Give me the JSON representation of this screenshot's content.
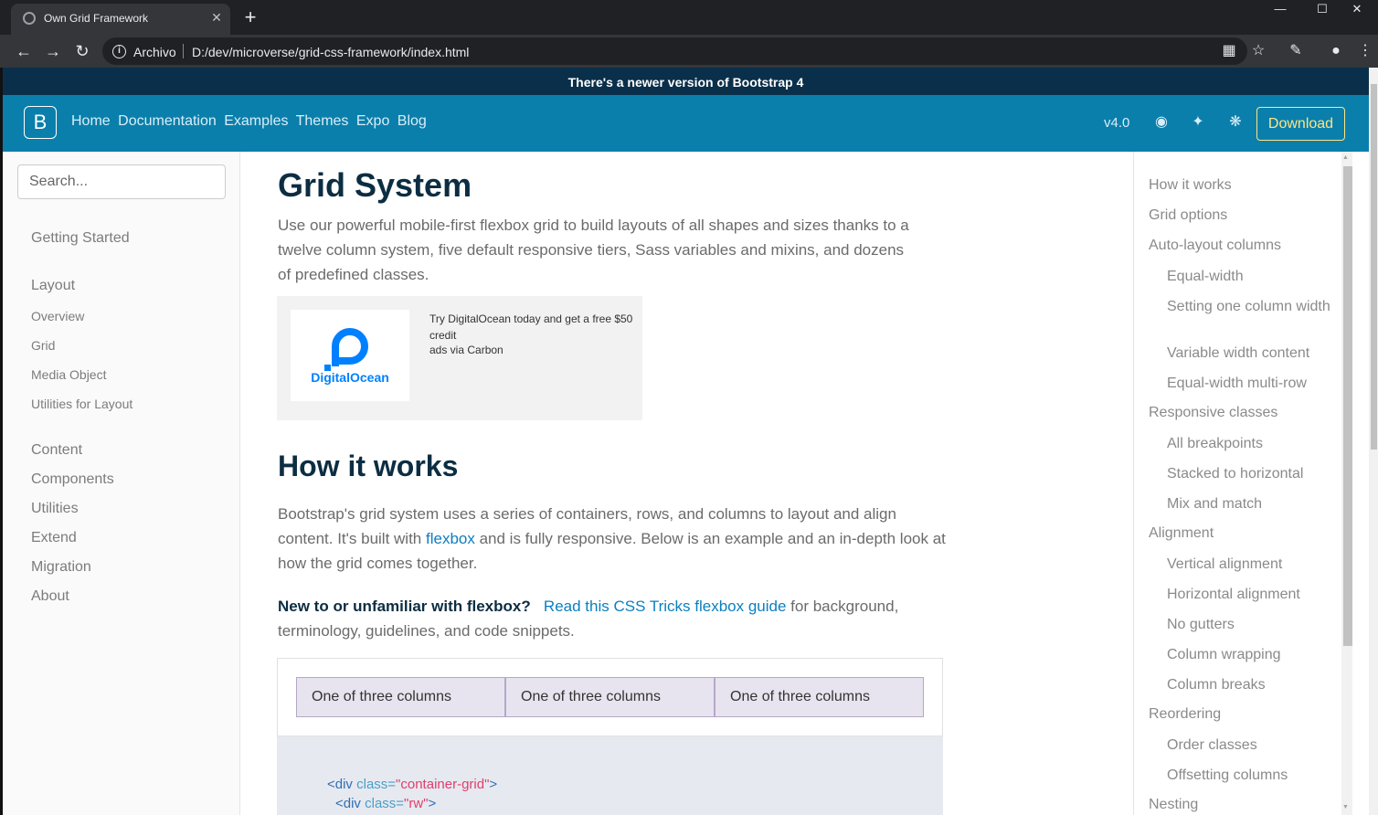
{
  "browser": {
    "tab_title": "Own Grid Framework",
    "tab_close": "✕",
    "new_tab": "+",
    "url_scheme": "Archivo",
    "url": "D:/dev/microverse/grid-css-framework/index.html",
    "window_controls": [
      "minimize-icon",
      "maximize-icon",
      "close-icon"
    ]
  },
  "announcement": "There's a newer version of Bootstrap 4",
  "navbar": {
    "brand": "B",
    "links": [
      "Home",
      "Documentation",
      "Examples",
      "Themes",
      "Expo",
      "Blog"
    ],
    "version": "v4.0",
    "download": "Download",
    "icons": [
      "github-icon",
      "twitter-icon",
      "slack-icon"
    ]
  },
  "sidebar": {
    "search_placeholder": "Search...",
    "getting_started": "Getting Started",
    "layout": "Layout",
    "layout_items": [
      "Overview",
      "Grid",
      "Media Object",
      "Utilities for Layout"
    ],
    "sections": [
      "Content",
      "Components",
      "Utilities",
      "Extend",
      "Migration",
      "About"
    ]
  },
  "main": {
    "title": "Grid System",
    "lead": "Use our powerful mobile-first flexbox grid to build layouts of all shapes and sizes thanks to a twelve column system, five default responsive tiers, Sass variables and mixins, and dozens of predefined classes.",
    "ad": {
      "logo_text": "DigitalOcean",
      "text": "Try DigitalOcean today and get a free $50 credit",
      "via": "ads via Carbon"
    },
    "how_title": "How it works",
    "how_text_1": "Bootstrap's grid system uses a series of containers, rows, and columns to layout and align content. It's built with ",
    "how_link": "flexbox",
    "how_text_2": " and is fully responsive. Below is an example and an in-depth look at how the grid comes together.",
    "new_bold": "New to or unfamiliar with flexbox?",
    "new_link": "Read this CSS Tricks flexbox guide",
    "new_text": " for background, terminology, guidelines, and code snippets.",
    "columns": [
      "One of three columns",
      "One of three columns",
      "One of three columns"
    ],
    "code": [
      {
        "open": "<div ",
        "attr": "class=",
        "str": "\"container-grid\"",
        "close": ">"
      },
      {
        "open": "<div ",
        "attr": "class=",
        "str": "\"rw\"",
        "close": ">"
      }
    ]
  },
  "toc": {
    "items": [
      {
        "label": "How it works",
        "sub": false
      },
      {
        "label": "Grid options",
        "sub": false
      },
      {
        "label": "Auto-layout columns",
        "sub": false
      },
      {
        "label": "Equal-width",
        "sub": true
      },
      {
        "label": "Setting one column width",
        "sub": true
      },
      {
        "label": "Variable width content",
        "sub": true
      },
      {
        "label": "Equal-width multi-row",
        "sub": true
      },
      {
        "label": "Responsive classes",
        "sub": false
      },
      {
        "label": "All breakpoints",
        "sub": true
      },
      {
        "label": "Stacked to horizontal",
        "sub": true
      },
      {
        "label": "Mix and match",
        "sub": true
      },
      {
        "label": "Alignment",
        "sub": false
      },
      {
        "label": "Vertical alignment",
        "sub": true
      },
      {
        "label": "Horizontal alignment",
        "sub": true
      },
      {
        "label": "No gutters",
        "sub": true
      },
      {
        "label": "Column wrapping",
        "sub": true
      },
      {
        "label": "Column breaks",
        "sub": true
      },
      {
        "label": "Reordering",
        "sub": false
      },
      {
        "label": "Order classes",
        "sub": true
      },
      {
        "label": "Offsetting columns",
        "sub": true
      },
      {
        "label": "Nesting",
        "sub": false
      }
    ]
  }
}
